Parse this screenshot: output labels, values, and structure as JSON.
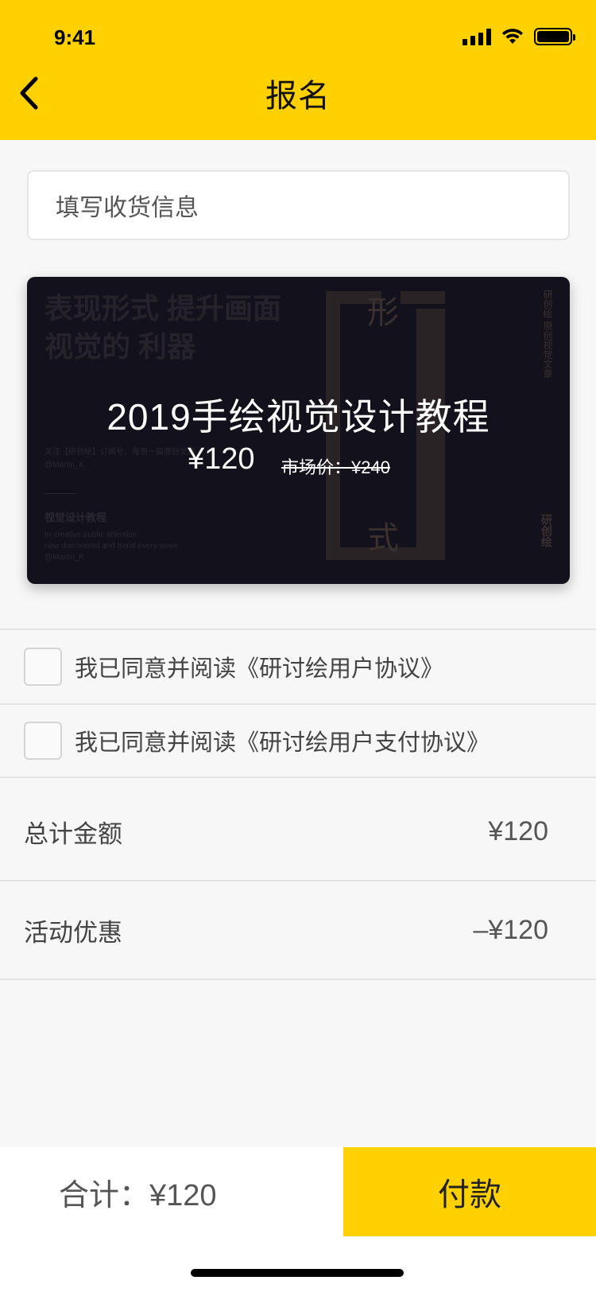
{
  "status_bar": {
    "time": "9:41"
  },
  "nav": {
    "title": "报名"
  },
  "address": {
    "label": "填写收货信息"
  },
  "course": {
    "title": "2019手绘视觉设计教程",
    "price": "¥120",
    "market_price": "市场价：¥240",
    "background_text": {
      "headline": "表现形式 提升画面视觉的 利器",
      "follow": "关注【研创绘】订阅号，每周一篇原创文章",
      "author": "@Martin_K",
      "section_title": "视觉设计教程",
      "lines": [
        "In creative public attention",
        "new discovered and trend every week",
        "@Martin_K"
      ],
      "glyph_top": "形",
      "glyph_bottom": "式",
      "vertical": "研创绘 原创视觉文章",
      "logo": "研创绘"
    }
  },
  "agreements": [
    {
      "label": "我已同意并阅读《研讨绘用户协议》",
      "checked": false
    },
    {
      "label": "我已同意并阅读《研讨绘用户支付协议》",
      "checked": false
    }
  ],
  "summary": {
    "total_label": "总计金额",
    "total_value": "¥120",
    "discount_label": "活动优惠",
    "discount_value": "–¥120"
  },
  "footer": {
    "total_text": "合计：¥120",
    "pay_label": "付款"
  },
  "colors": {
    "accent": "#ffd100",
    "card_bg": "#13121c",
    "page_bg": "#f7f7f7"
  }
}
